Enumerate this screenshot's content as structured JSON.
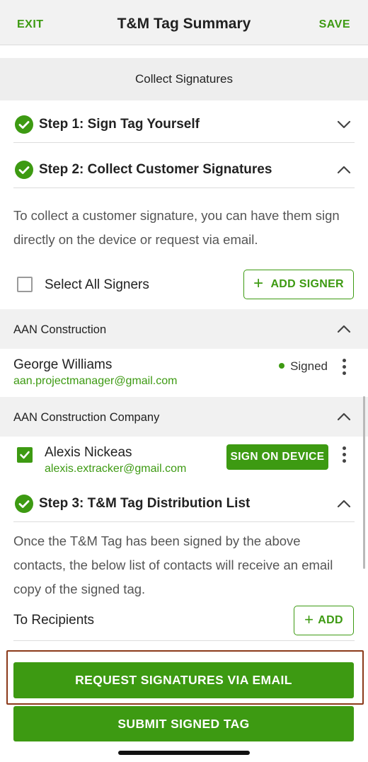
{
  "header": {
    "exit_label": "EXIT",
    "title": "T&M Tag Summary",
    "save_label": "SAVE"
  },
  "section": {
    "title": "Collect Signatures"
  },
  "steps": [
    {
      "label": "Step 1: Sign Tag Yourself",
      "completed": true,
      "expanded": false,
      "icon": "chevron-down-icon"
    },
    {
      "label": "Step 2: Collect Customer Signatures",
      "completed": true,
      "expanded": true,
      "icon": "chevron-up-icon"
    },
    {
      "label": "Step 3: T&M Tag Distribution List",
      "completed": true,
      "expanded": true,
      "icon": "chevron-up-icon"
    }
  ],
  "step2": {
    "description": "To collect a customer signature, you can have them sign directly on the device or request via email.",
    "select_all_label": "Select All Signers",
    "select_all_checked": false,
    "add_signer_label": "ADD SIGNER"
  },
  "groups": [
    {
      "name": "AAN Construction",
      "signers": [
        {
          "name": "George Williams",
          "email": "aan.projectmanager@gmail.com",
          "status": "Signed"
        }
      ]
    },
    {
      "name": "AAN Construction Company",
      "signers": [
        {
          "name": "Alexis Nickeas",
          "email": "alexis.extracker@gmail.com",
          "checked": true,
          "action": "SIGN ON DEVICE"
        }
      ]
    }
  ],
  "step3": {
    "description": "Once the T&M Tag has been signed by the above contacts, the below list of contacts will receive an email copy of the signed tag.",
    "to_recipients_label": "To Recipients",
    "add_label": "ADD"
  },
  "actions": {
    "request_label": "REQUEST SIGNATURES VIA EMAIL",
    "submit_label": "SUBMIT SIGNED TAG"
  },
  "colors": {
    "accent": "#3d9a12",
    "highlight_border": "#8b3a1a",
    "section_background": "#eeeeee"
  }
}
